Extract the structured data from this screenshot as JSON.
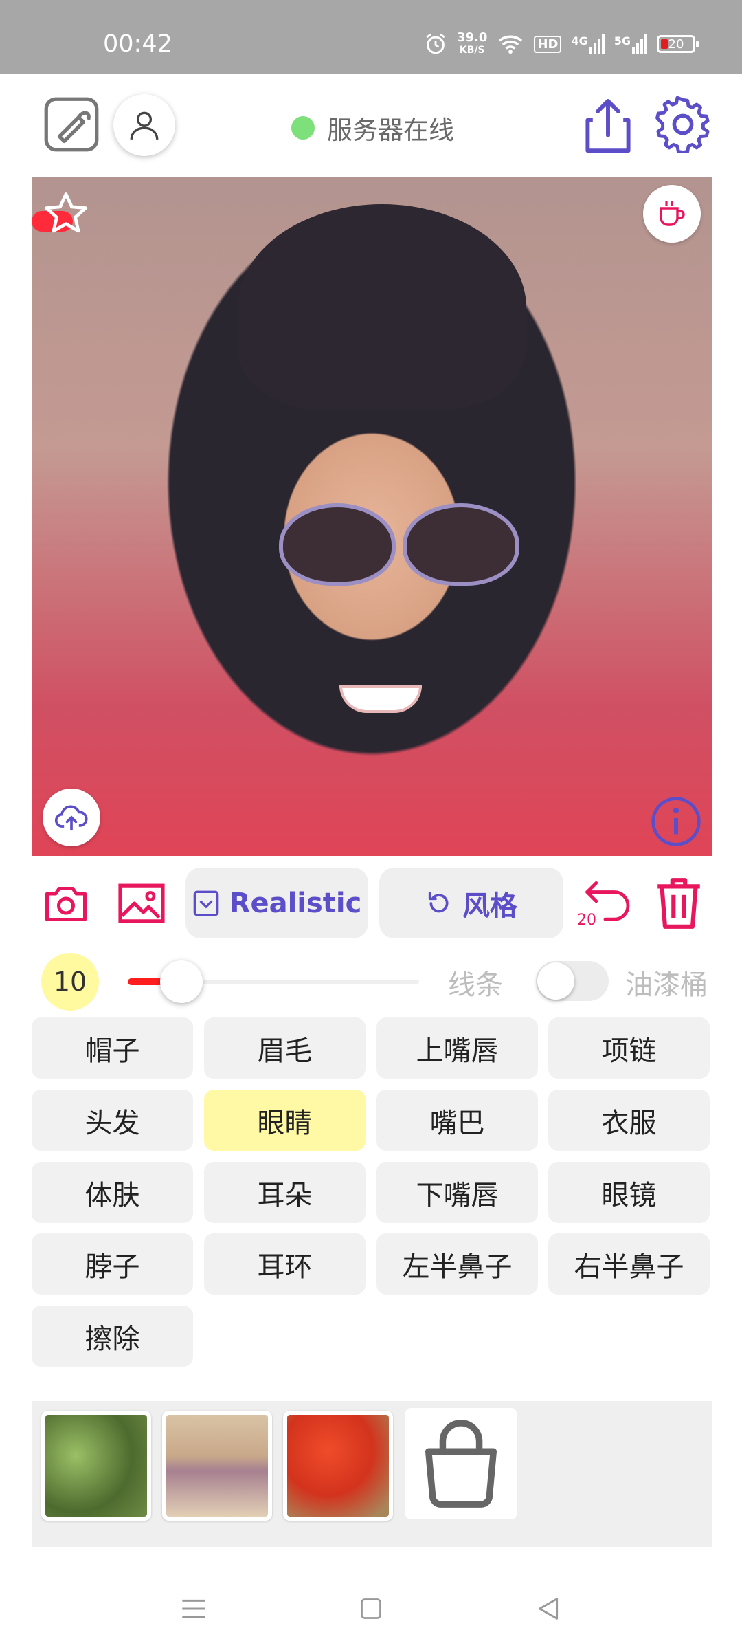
{
  "status_bar": {
    "time": "00:42",
    "network_speed_value": "39.0",
    "network_speed_unit": "KB/S",
    "hd_label": "HD",
    "net_4g": "4G",
    "net_5g": "5G",
    "battery": "20",
    "icons": [
      "alarm-icon",
      "wifi-icon",
      "hd-icon",
      "signal-4g-icon",
      "signal-5g-icon",
      "battery-icon"
    ]
  },
  "header": {
    "server_status": "服务器在线",
    "server_status_color": "#7ee07a",
    "accent_color": "#5b4ec8"
  },
  "canvas": {
    "icons": [
      "star-icon",
      "coffee-icon",
      "upload-cloud-icon",
      "info-icon"
    ]
  },
  "toolbar": {
    "mode_label": "Realistic",
    "style_label": "风格",
    "undo_count": "20",
    "accent_pink": "#e8175d"
  },
  "brush": {
    "size": "10",
    "slider_fraction": 0.12,
    "line_label": "线条",
    "paint_bucket_label": "油漆桶",
    "paint_bucket_enabled": false
  },
  "parts": [
    {
      "label": "帽子",
      "selected": false
    },
    {
      "label": "眉毛",
      "selected": false
    },
    {
      "label": "上嘴唇",
      "selected": false
    },
    {
      "label": "项链",
      "selected": false
    },
    {
      "label": "头发",
      "selected": false
    },
    {
      "label": "眼睛",
      "selected": true
    },
    {
      "label": "嘴巴",
      "selected": false
    },
    {
      "label": "衣服",
      "selected": false
    },
    {
      "label": "体肤",
      "selected": false
    },
    {
      "label": "耳朵",
      "selected": false
    },
    {
      "label": "下嘴唇",
      "selected": false
    },
    {
      "label": "眼镜",
      "selected": false
    },
    {
      "label": "脖子",
      "selected": false
    },
    {
      "label": "耳环",
      "selected": false
    },
    {
      "label": "左半鼻子",
      "selected": false
    },
    {
      "label": "右半鼻子",
      "selected": false
    },
    {
      "label": "擦除",
      "selected": false
    }
  ],
  "nav": {
    "icons": [
      "menu-icon",
      "home-icon",
      "back-icon"
    ]
  }
}
